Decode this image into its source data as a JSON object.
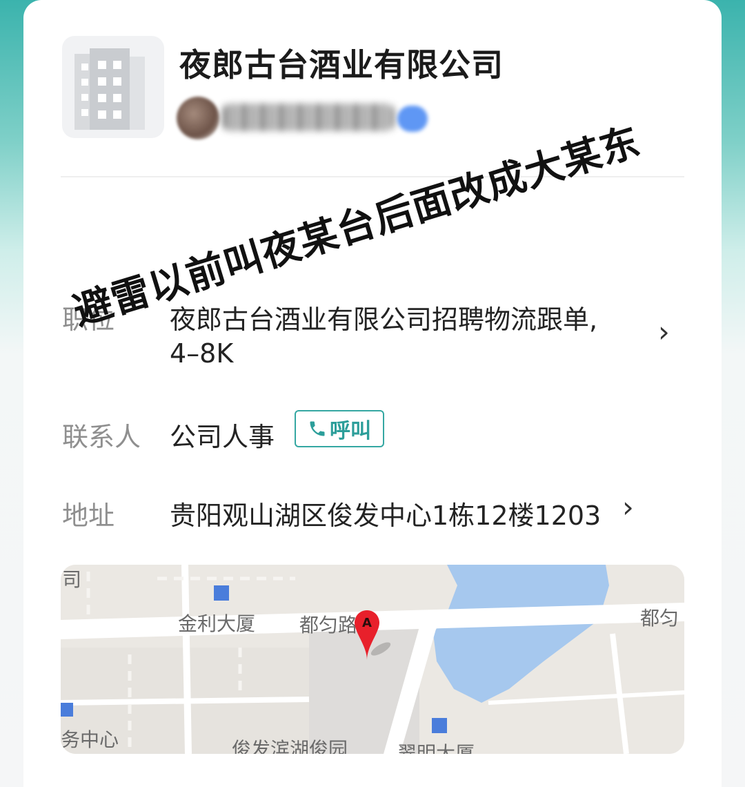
{
  "company": {
    "name": "夜郎古台酒业有限公司",
    "logo_icon": "building-icon"
  },
  "overlay_text": "避雷以前叫夜某台后面改成大某东",
  "position": {
    "label": "职位",
    "value_line1": "夜郎古台酒业有限公司招聘物流跟单,",
    "value_line2": "4–8K"
  },
  "contact": {
    "label": "联系人",
    "value": "公司人事",
    "call_label": "呼叫"
  },
  "address": {
    "label": "地址",
    "value": "贵阳观山湖区俊发中心1栋12楼1203"
  },
  "map": {
    "labels": {
      "top_left": "司",
      "building1": "金利大厦",
      "road1": "都匀路",
      "road2": "都匀",
      "left": "务中心",
      "bottom1": "俊发滨湖俊园",
      "bottom2": "翠明大厦"
    },
    "marker_letter": "A"
  },
  "colors": {
    "accent": "#34a7a2",
    "marker": "#e8202b",
    "water": "#a6c8ee"
  }
}
